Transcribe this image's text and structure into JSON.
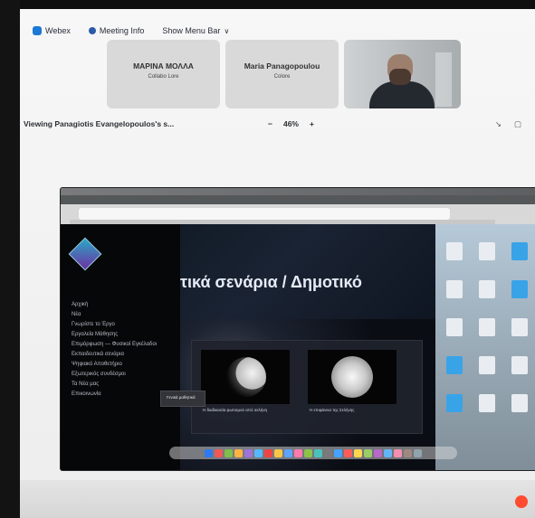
{
  "menu": {
    "webex": "Webex",
    "meeting_info": "Meeting Info",
    "show_menu_bar": "Show Menu Bar",
    "chevron": "∨"
  },
  "participants": [
    {
      "name": "ΜΑΡΙΝΑ ΜΟΛΛΑ",
      "sub": "Collabo Lore"
    },
    {
      "name": "Maria Panagopoulou",
      "sub": "Colore"
    }
  ],
  "status": {
    "viewing": "Viewing Panagiotis Evangelopoulos's s...",
    "zoom_minus": "−",
    "zoom": "46%",
    "zoom_plus": "+",
    "icon_left": "↘",
    "icon_right": "▢"
  },
  "shared_page": {
    "hero_title": "τικά σενάρια / Δημοτικό",
    "menu_items": [
      "Αρχική",
      "Νέα",
      "Γνωρίστε το Έργο",
      "Εργαλεία Μάθησης",
      "Επιμόρφωση — Φυσικοί Εγκέλαδοι",
      "Εκπαιδευτικά σενάρια",
      "Ψηφιακό Αποθετήριο",
      "Εξωτερικός συνδέσμοι",
      "Τα Νέα μας",
      "Επικοινωνία"
    ],
    "popup": "Γενικά μαθητικά",
    "cards": [
      {
        "caption": "Η διαδικασία φωτισμού από σελήνη"
      },
      {
        "caption": "Η επιφάνεια της Σελήνης"
      }
    ]
  },
  "colors": {
    "accent": "#1d78d6",
    "recording": "#ff4b2f"
  }
}
